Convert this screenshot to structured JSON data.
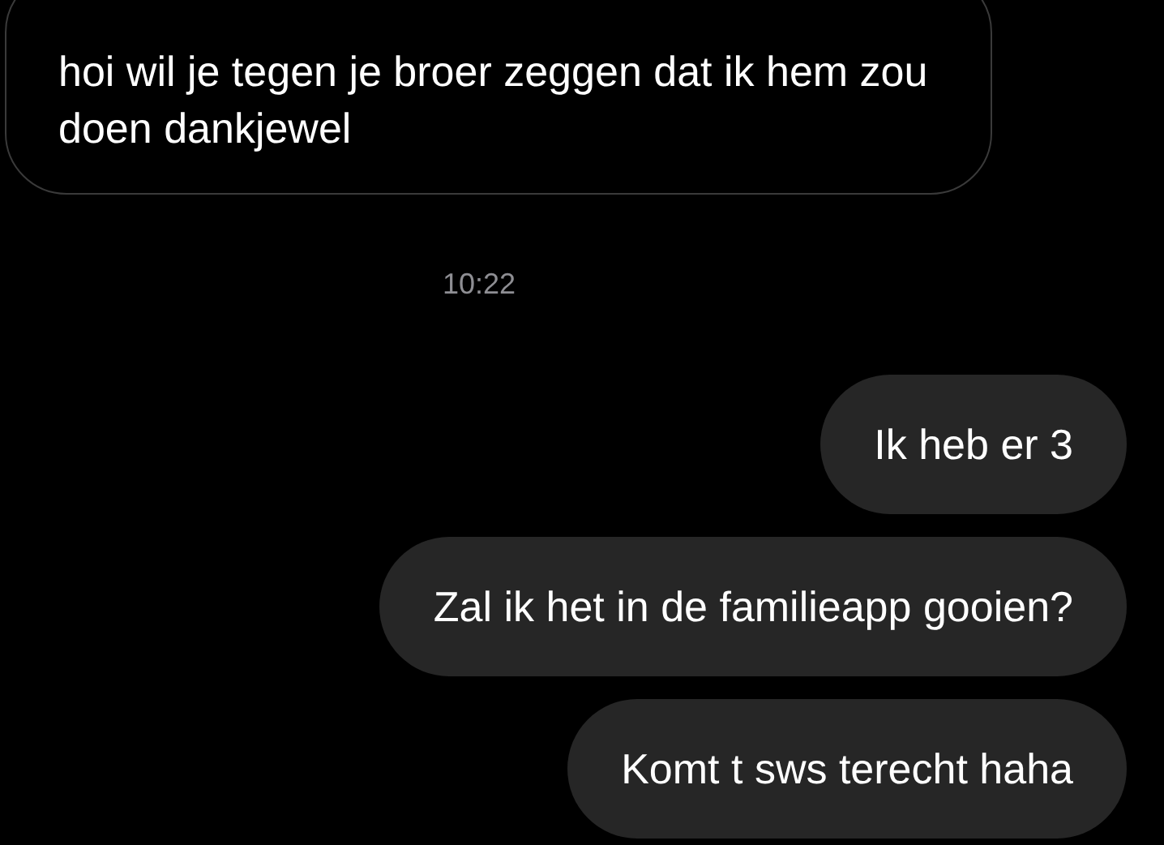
{
  "messages": [
    {
      "kind": "received",
      "text": "hoi wil je tegen je broer zeggen dat ik hem zou doen dankjewel"
    },
    {
      "kind": "timestamp",
      "text": "10:22"
    },
    {
      "kind": "sent",
      "text": "Ik heb er 3"
    },
    {
      "kind": "sent",
      "text": "Zal ik het in de familieapp gooien?"
    },
    {
      "kind": "sent",
      "text": "Komt t sws terecht haha"
    }
  ]
}
